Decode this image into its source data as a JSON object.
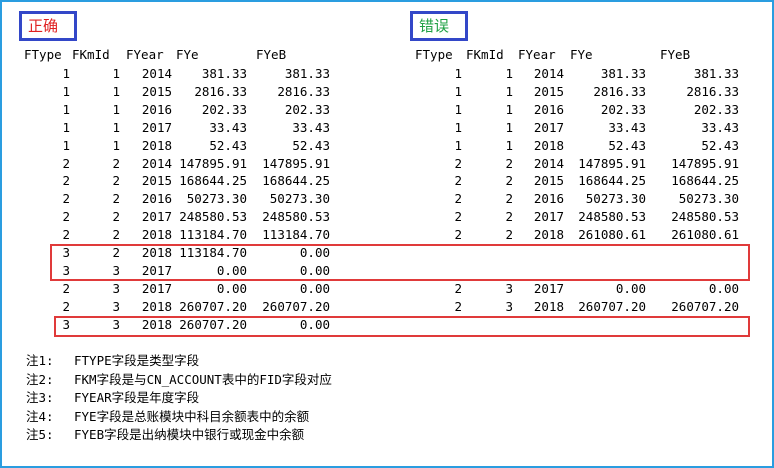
{
  "labels": {
    "correct": "正确",
    "wrong": "错误"
  },
  "columns": [
    "FType",
    "FKmId",
    "FYear",
    "FYe",
    "FYeB"
  ],
  "left_rows": [
    [
      "1",
      "1",
      "2014",
      "381.33",
      "381.33"
    ],
    [
      "1",
      "1",
      "2015",
      "2816.33",
      "2816.33"
    ],
    [
      "1",
      "1",
      "2016",
      "202.33",
      "202.33"
    ],
    [
      "1",
      "1",
      "2017",
      "33.43",
      "33.43"
    ],
    [
      "1",
      "1",
      "2018",
      "52.43",
      "52.43"
    ],
    [
      "2",
      "2",
      "2014",
      "147895.91",
      "147895.91"
    ],
    [
      "2",
      "2",
      "2015",
      "168644.25",
      "168644.25"
    ],
    [
      "2",
      "2",
      "2016",
      "50273.30",
      "50273.30"
    ],
    [
      "2",
      "2",
      "2017",
      "248580.53",
      "248580.53"
    ],
    [
      "2",
      "2",
      "2018",
      "113184.70",
      "113184.70"
    ],
    [
      "3",
      "2",
      "2018",
      "113184.70",
      "0.00"
    ],
    [
      "3",
      "3",
      "2017",
      "0.00",
      "0.00"
    ],
    [
      "2",
      "3",
      "2017",
      "0.00",
      "0.00"
    ],
    [
      "2",
      "3",
      "2018",
      "260707.20",
      "260707.20"
    ],
    [
      "3",
      "3",
      "2018",
      "260707.20",
      "0.00"
    ]
  ],
  "right_rows": [
    [
      "1",
      "1",
      "2014",
      "381.33",
      "381.33"
    ],
    [
      "1",
      "1",
      "2015",
      "2816.33",
      "2816.33"
    ],
    [
      "1",
      "1",
      "2016",
      "202.33",
      "202.33"
    ],
    [
      "1",
      "1",
      "2017",
      "33.43",
      "33.43"
    ],
    [
      "1",
      "1",
      "2018",
      "52.43",
      "52.43"
    ],
    [
      "2",
      "2",
      "2014",
      "147895.91",
      "147895.91"
    ],
    [
      "2",
      "2",
      "2015",
      "168644.25",
      "168644.25"
    ],
    [
      "2",
      "2",
      "2016",
      "50273.30",
      "50273.30"
    ],
    [
      "2",
      "2",
      "2017",
      "248580.53",
      "248580.53"
    ],
    [
      "2",
      "2",
      "2018",
      "261080.61",
      "261080.61"
    ],
    [
      "",
      "",
      "",
      "",
      ""
    ],
    [
      "",
      "",
      "",
      "",
      ""
    ],
    [
      "2",
      "3",
      "2017",
      "0.00",
      "0.00"
    ],
    [
      "2",
      "3",
      "2018",
      "260707.20",
      "260707.20"
    ],
    [
      "",
      "",
      "",
      "",
      ""
    ]
  ],
  "notes": [
    {
      "label": "注1:",
      "text": "FTYPE字段是类型字段"
    },
    {
      "label": "注2:",
      "text": "FKM字段是与CN_ACCOUNT表中的FID字段对应"
    },
    {
      "label": "注3:",
      "text": "FYEAR字段是年度字段"
    },
    {
      "label": "注4:",
      "text": "FYE字段是总账模块中科目余额表中的余额"
    },
    {
      "label": "注5:",
      "text": "FYEB字段是出纳模块中银行或现金中余额"
    }
  ]
}
